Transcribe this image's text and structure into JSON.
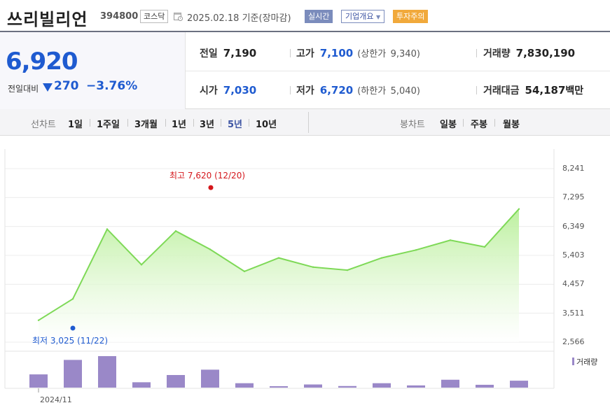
{
  "header": {
    "stock_name": "쓰리빌리언",
    "stock_code": "394800",
    "market": "코스닥",
    "date": "2025.02.18",
    "basis": "기준(장마감)",
    "realtime_label": "실시간",
    "company_info_label": "기업개요",
    "warning_label": "투자주의"
  },
  "price": {
    "current": "6,920",
    "change_label": "전일대비",
    "change_value": "270",
    "change_percent": "−3.76%"
  },
  "stats": {
    "prev_close_label": "전일",
    "prev_close": "7,190",
    "high_label": "고가",
    "high": "7,100",
    "upper_limit_label": "(상한가",
    "upper_limit": "9,340)",
    "volume_label": "거래량",
    "volume": "7,830,190",
    "open_label": "시가",
    "open": "7,030",
    "low_label": "저가",
    "low": "6,720",
    "lower_limit_label": "(하한가",
    "lower_limit": "5,040)",
    "trade_value_label": "거래대금",
    "trade_value": "54,187",
    "trade_value_unit": "백만"
  },
  "period_tabs": {
    "line_chart_label": "선차트",
    "items": [
      "1일",
      "1주일",
      "3개월",
      "1년",
      "3년",
      "5년",
      "10년"
    ],
    "active": "5년",
    "candle_chart_label": "봉차트",
    "candle_items": [
      "일봉",
      "주봉",
      "월봉"
    ]
  },
  "colors": {
    "price_down": "#1f5bd0",
    "line": "#7ed957",
    "fill_top": "#b9ef9a",
    "volume_bar": "#9a88c8",
    "high_marker": "#d4161b",
    "low_marker": "#1f5bd0"
  },
  "chart_data": {
    "type": "area",
    "y_ticks": [
      "8,241",
      "7,295",
      "6,349",
      "5,403",
      "4,457",
      "3,511",
      "2,566"
    ],
    "ylim": [
      2566,
      8241
    ],
    "x_tick_label": "2024/11",
    "high_annotation": "최고 7,620 (12/20)",
    "low_annotation": "최저 3,025 (11/22)",
    "high_value": 7620,
    "low_value": 3025,
    "series": [
      {
        "values": [
          3280,
          3980,
          6260,
          5100,
          6200,
          5600,
          4880,
          5320,
          5020,
          4920,
          5320,
          5580,
          5900,
          5680,
          6920
        ]
      }
    ],
    "volume_legend": "거래량",
    "volume_relative": [
      0.42,
      0.88,
      1.0,
      0.17,
      0.4,
      0.57,
      0.14,
      0.04,
      0.1,
      0.05,
      0.14,
      0.07,
      0.25,
      0.09,
      0.22
    ]
  }
}
